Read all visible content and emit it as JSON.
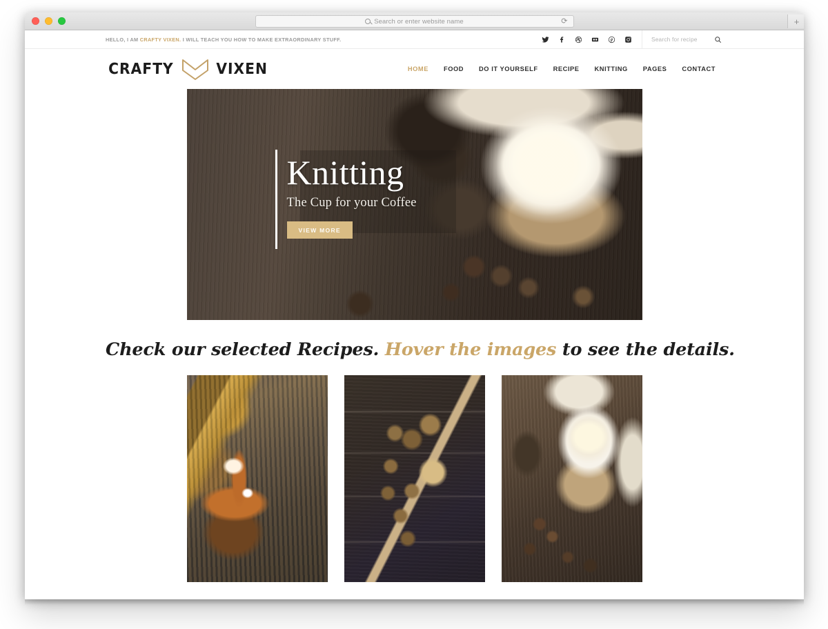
{
  "browser": {
    "url_placeholder": "Search or enter website name",
    "reload_icon": "reload-icon",
    "newtab_label": "+",
    "traffic_lights": [
      "close",
      "minimize",
      "zoom"
    ]
  },
  "topbar": {
    "tagline_before": "HELLO, I AM ",
    "tagline_brand": "CRAFTY VIXEN.",
    "tagline_after": " I WILL TEACH YOU HOW TO MAKE EXTRAORDINARY STUFF.",
    "socials": [
      {
        "name": "twitter-icon",
        "label": "Twitter"
      },
      {
        "name": "facebook-icon",
        "label": "Facebook"
      },
      {
        "name": "dribbble-icon",
        "label": "Dribbble"
      },
      {
        "name": "flickr-icon",
        "label": "Flickr"
      },
      {
        "name": "pinterest-icon",
        "label": "Pinterest"
      },
      {
        "name": "instagram-icon",
        "label": "Instagram"
      }
    ],
    "search_placeholder": "Search for recipe",
    "search_value": ""
  },
  "header": {
    "logo_left": "CRAFTY",
    "logo_right": "VIXEN",
    "logo_mark": "fox-mark-icon",
    "nav": [
      {
        "label": "HOME",
        "active": true
      },
      {
        "label": "FOOD",
        "active": false
      },
      {
        "label": "DO IT YOURSELF",
        "active": false
      },
      {
        "label": "RECIPE",
        "active": false
      },
      {
        "label": "KNITTING",
        "active": false
      },
      {
        "label": "PAGES",
        "active": false
      },
      {
        "label": "CONTACT",
        "active": false
      }
    ]
  },
  "hero": {
    "title": "Knitting",
    "subtitle": "The Cup for your Coffee",
    "button_label": "VIEW MORE",
    "image_alt": "Mug of tea with lemon in a knitted cozy on rustic wood with pinecones"
  },
  "recipes": {
    "heading_part1": "Check our selected Recipes. ",
    "heading_highlight": "Hover the images",
    "heading_part2": " to see the details.",
    "cards": [
      {
        "name": "recipe-card-caramel-cupcake",
        "alt": "Caramel sauce poured from a spoon onto a cupcake"
      },
      {
        "name": "recipe-card-spices",
        "alt": "Star anise and pinecones with a small bowl and brush on dark wood"
      },
      {
        "name": "recipe-card-knitted-mug",
        "alt": "White mug with lemon slice wrapped in a knitted cozy beside a scarf"
      }
    ]
  },
  "colors": {
    "accent_gold": "#caa668",
    "button_gold": "#d9bc84",
    "text_dark": "#1d1d1d",
    "muted_gray": "#9a9a9a"
  }
}
